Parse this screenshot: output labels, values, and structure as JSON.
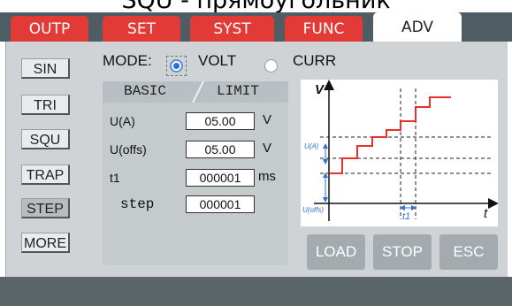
{
  "caption": "SQU - прямоугольник",
  "tabs": [
    "OUTP",
    "SET",
    "SYST",
    "FUNC",
    "ADV"
  ],
  "waveforms": [
    "SIN",
    "TRI",
    "SQU",
    "TRAP",
    "STEP",
    "MORE"
  ],
  "selected_waveform": "STEP",
  "mode": {
    "label": "MODE:",
    "option_volt": "VOLT",
    "option_curr": "CURR",
    "selected": "VOLT"
  },
  "subtabs": {
    "basic": "BASIC",
    "limit": "LIMIT"
  },
  "params": [
    {
      "label": "U(A)",
      "value": "05.00",
      "unit": "V"
    },
    {
      "label": "U(offs)",
      "value": "05.00",
      "unit": "V"
    },
    {
      "label": "t1",
      "value": "000001",
      "unit": "ms"
    },
    {
      "label": "step",
      "value": "000001",
      "unit": ""
    }
  ],
  "graph": {
    "v_axis": "V",
    "t_axis": "t",
    "ua_label": "U(A)",
    "uoffs_label": "U(offs)",
    "t1_label": "t1"
  },
  "actions": {
    "load": "LOAD",
    "stop": "STOP",
    "esc": "ESC"
  },
  "colors": {
    "tab_red": "#e23a36",
    "step_line": "#e8302c",
    "dim_blue": "#2f6fd6",
    "button_gray": "#a4abaf"
  }
}
